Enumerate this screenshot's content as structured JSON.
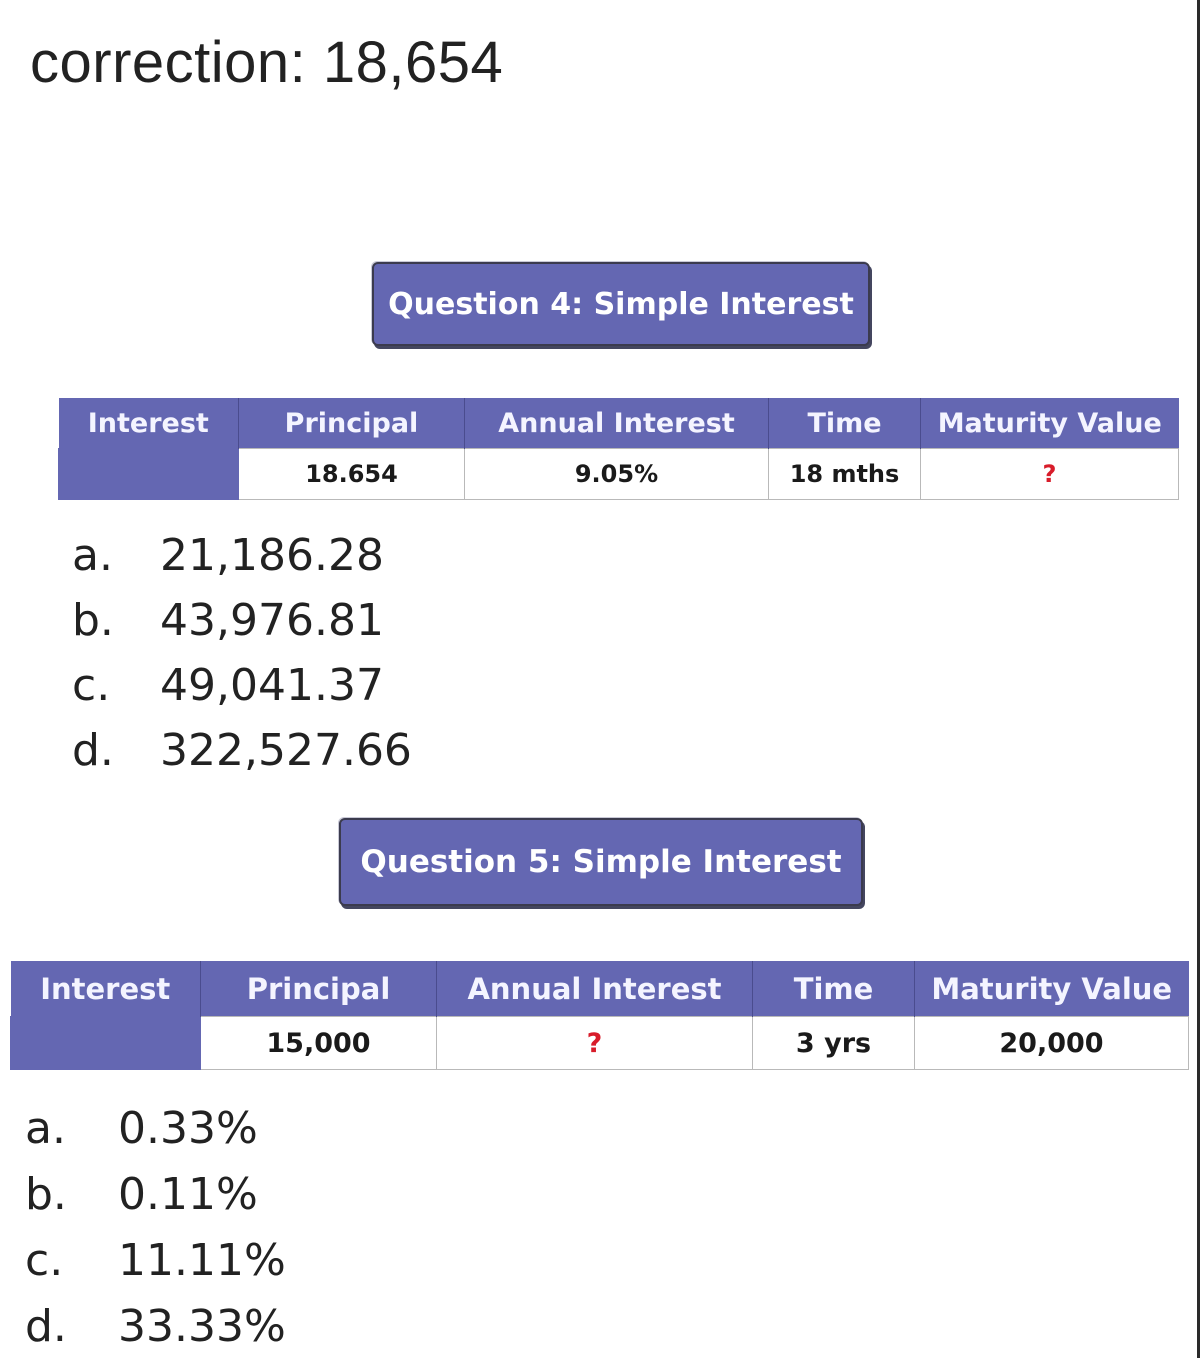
{
  "correction": "correction: 18,654",
  "colors": {
    "header_purple": "#6467b2",
    "unknown_red": "#d81c2a",
    "text_dark": "#1c1c1c"
  },
  "questions": [
    {
      "title": "Question 4: Simple Interest",
      "table": {
        "headers": [
          "Interest",
          "Principal",
          "Annual Interest",
          "Time",
          "Maturity Value"
        ],
        "values": [
          "",
          "18.654",
          "9.05%",
          "18 mths",
          "?"
        ]
      },
      "options": [
        {
          "letter": "a.",
          "value": "21,186.28"
        },
        {
          "letter": "b.",
          "value": "43,976.81"
        },
        {
          "letter": "c.",
          "value": "49,041.37"
        },
        {
          "letter": "d.",
          "value": "322,527.66"
        }
      ]
    },
    {
      "title": "Question 5: Simple Interest",
      "table": {
        "headers": [
          "Interest",
          "Principal",
          "Annual Interest",
          "Time",
          "Maturity Value"
        ],
        "values": [
          "",
          "15,000",
          "?",
          "3 yrs",
          "20,000"
        ]
      },
      "options": [
        {
          "letter": "a.",
          "value": "0.33%"
        },
        {
          "letter": "b.",
          "value": "0.11%"
        },
        {
          "letter": "c.",
          "value": "11.11%"
        },
        {
          "letter": "d.",
          "value": "33.33%"
        }
      ]
    }
  ]
}
